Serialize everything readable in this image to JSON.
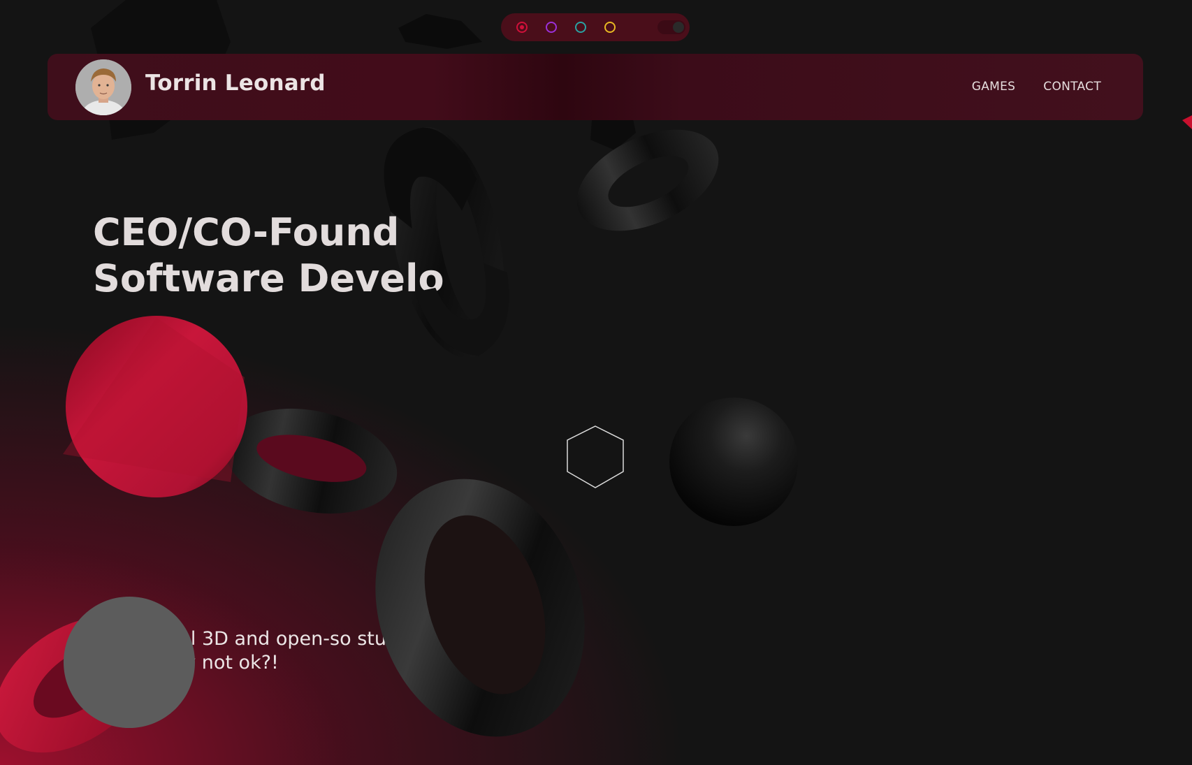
{
  "theme_switcher": {
    "options": [
      {
        "name": "red",
        "color": "#d0103a",
        "active": true
      },
      {
        "name": "purple",
        "color": "#9b30d9",
        "active": false
      },
      {
        "name": "teal",
        "color": "#2aa3a3",
        "active": false
      },
      {
        "name": "yellow",
        "color": "#e8b923",
        "active": false
      }
    ]
  },
  "header": {
    "name": "Torrin Leonard",
    "nav": {
      "games": "GAMES",
      "contact": "CONTACT"
    }
  },
  "hero": {
    "title_line1": "CEO/CO-Found",
    "title_line2": "Software Develo",
    "subtitle_line1": "cool 3D and open-so     stuff,",
    "subtitle_line2": "why not ok?!"
  },
  "colors": {
    "accent": "#c8102e",
    "background": "#141414",
    "navbar": "#400e1b"
  }
}
